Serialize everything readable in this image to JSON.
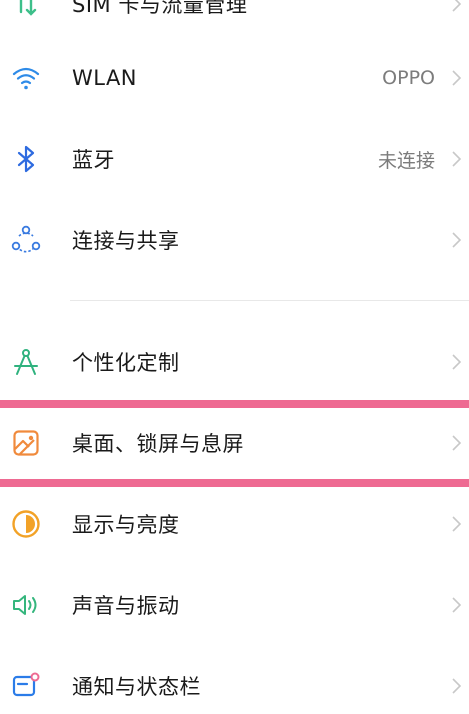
{
  "settings": {
    "items": [
      {
        "name": "sim-data",
        "label": "SIM 卡与流量管理",
        "value": ""
      },
      {
        "name": "wlan",
        "label": "WLAN",
        "value": "OPPO"
      },
      {
        "name": "bluetooth",
        "label": "蓝牙",
        "value": "未连接"
      },
      {
        "name": "connection-sharing",
        "label": "连接与共享",
        "value": ""
      },
      {
        "name": "personalization",
        "label": "个性化定制",
        "value": ""
      },
      {
        "name": "home-lock-screen",
        "label": "桌面、锁屏与息屏",
        "value": ""
      },
      {
        "name": "display-brightness",
        "label": "显示与亮度",
        "value": ""
      },
      {
        "name": "sound-vibration",
        "label": "声音与振动",
        "value": ""
      },
      {
        "name": "notification-status-bar",
        "label": "通知与状态栏",
        "value": ""
      }
    ]
  },
  "colors": {
    "highlight": "#ee6a92",
    "sim_icon": "#3dbf8a",
    "wlan_icon": "#2e8be8",
    "bluetooth_icon": "#2e6be0",
    "share_icon": "#3a7be0",
    "personalize_icon": "#2fb27e",
    "desktop_icon": "#f08a3c",
    "display_icon": "#f2a227",
    "sound_icon": "#35b67d",
    "notify_icon": "#2b7ce8"
  }
}
